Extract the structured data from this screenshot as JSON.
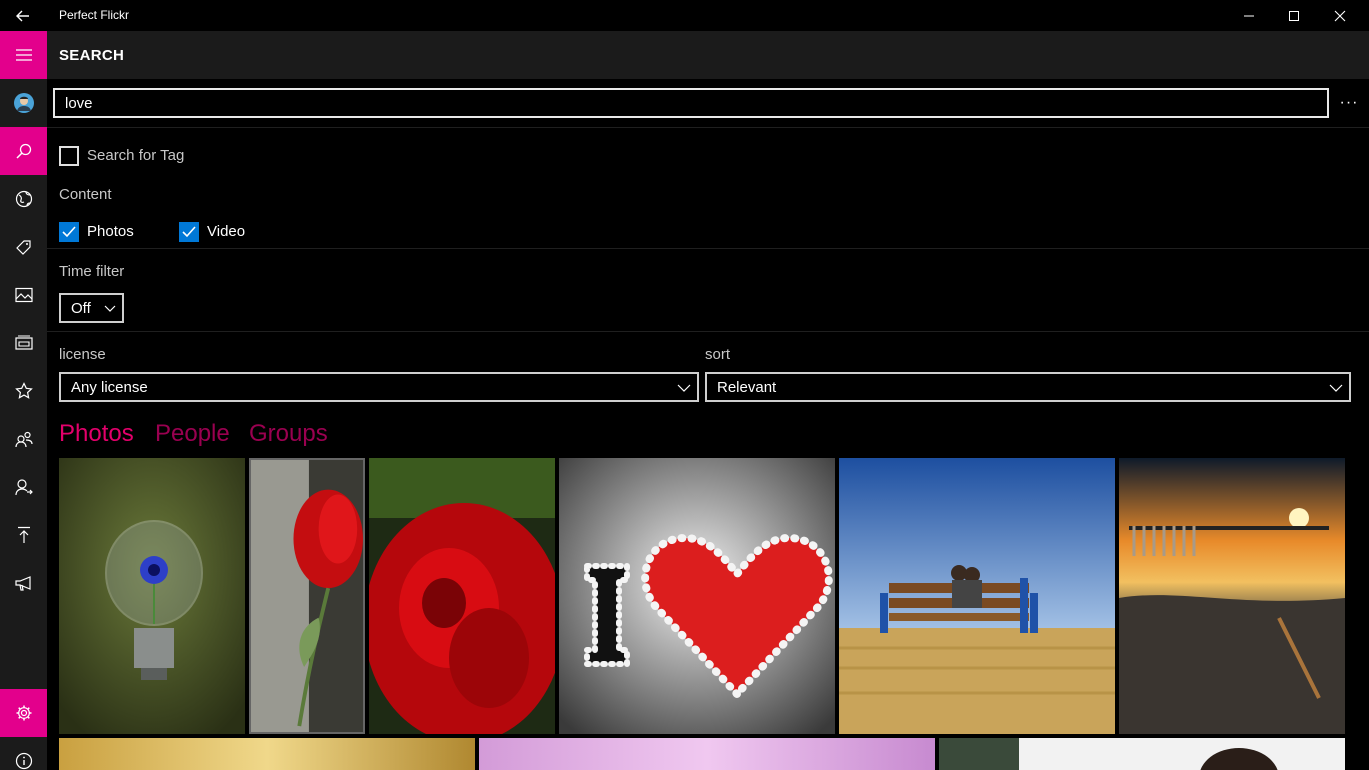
{
  "titlebar": {
    "app_title": "Perfect Flickr",
    "back_icon": "back-arrow-icon",
    "minimize_icon": "minimize-icon",
    "maximize_icon": "maximize-icon",
    "close_icon": "close-icon"
  },
  "header": {
    "title": "SEARCH"
  },
  "sidebar": {
    "accent_color": "#e3008c",
    "items": [
      {
        "name": "hamburger-menu",
        "icon": "hamburger-icon"
      },
      {
        "name": "account",
        "icon": "avatar-icon"
      },
      {
        "name": "search",
        "icon": "search-icon"
      },
      {
        "name": "explore",
        "icon": "globe-icon"
      },
      {
        "name": "tags",
        "icon": "tag-icon"
      },
      {
        "name": "photos",
        "icon": "image-icon"
      },
      {
        "name": "albums",
        "icon": "album-icon"
      },
      {
        "name": "favorites",
        "icon": "star-icon"
      },
      {
        "name": "groups",
        "icon": "people-icon"
      },
      {
        "name": "contacts",
        "icon": "contact-icon"
      },
      {
        "name": "upload",
        "icon": "upload-icon"
      },
      {
        "name": "feedback",
        "icon": "megaphone-icon"
      },
      {
        "name": "settings",
        "icon": "gear-icon"
      },
      {
        "name": "about",
        "icon": "info-icon"
      }
    ]
  },
  "search": {
    "value": "love",
    "more_label": "···"
  },
  "filters": {
    "search_for_tag": {
      "label": "Search for Tag",
      "checked": false
    },
    "content_label": "Content",
    "photos": {
      "label": "Photos",
      "checked": true
    },
    "video": {
      "label": "Video",
      "checked": true
    },
    "time_filter_label": "Time filter",
    "time_filter_value": "Off",
    "license_label": "license",
    "license_value": "Any license",
    "sort_label": "sort",
    "sort_value": "Relevant"
  },
  "tabs": [
    {
      "label": "Photos",
      "active": true
    },
    {
      "label": "People",
      "active": false
    },
    {
      "label": "Groups",
      "active": false
    }
  ],
  "photos": [
    {
      "subject": "lightbulb with blue flower"
    },
    {
      "subject": "red rose bud"
    },
    {
      "subject": "red rose close-up"
    },
    {
      "subject": "pearl heart I love"
    },
    {
      "subject": "couple on bench"
    },
    {
      "subject": "sunset beach"
    },
    {
      "subject": "golden field"
    },
    {
      "subject": "pink sky"
    },
    {
      "subject": "person portrait"
    }
  ]
}
